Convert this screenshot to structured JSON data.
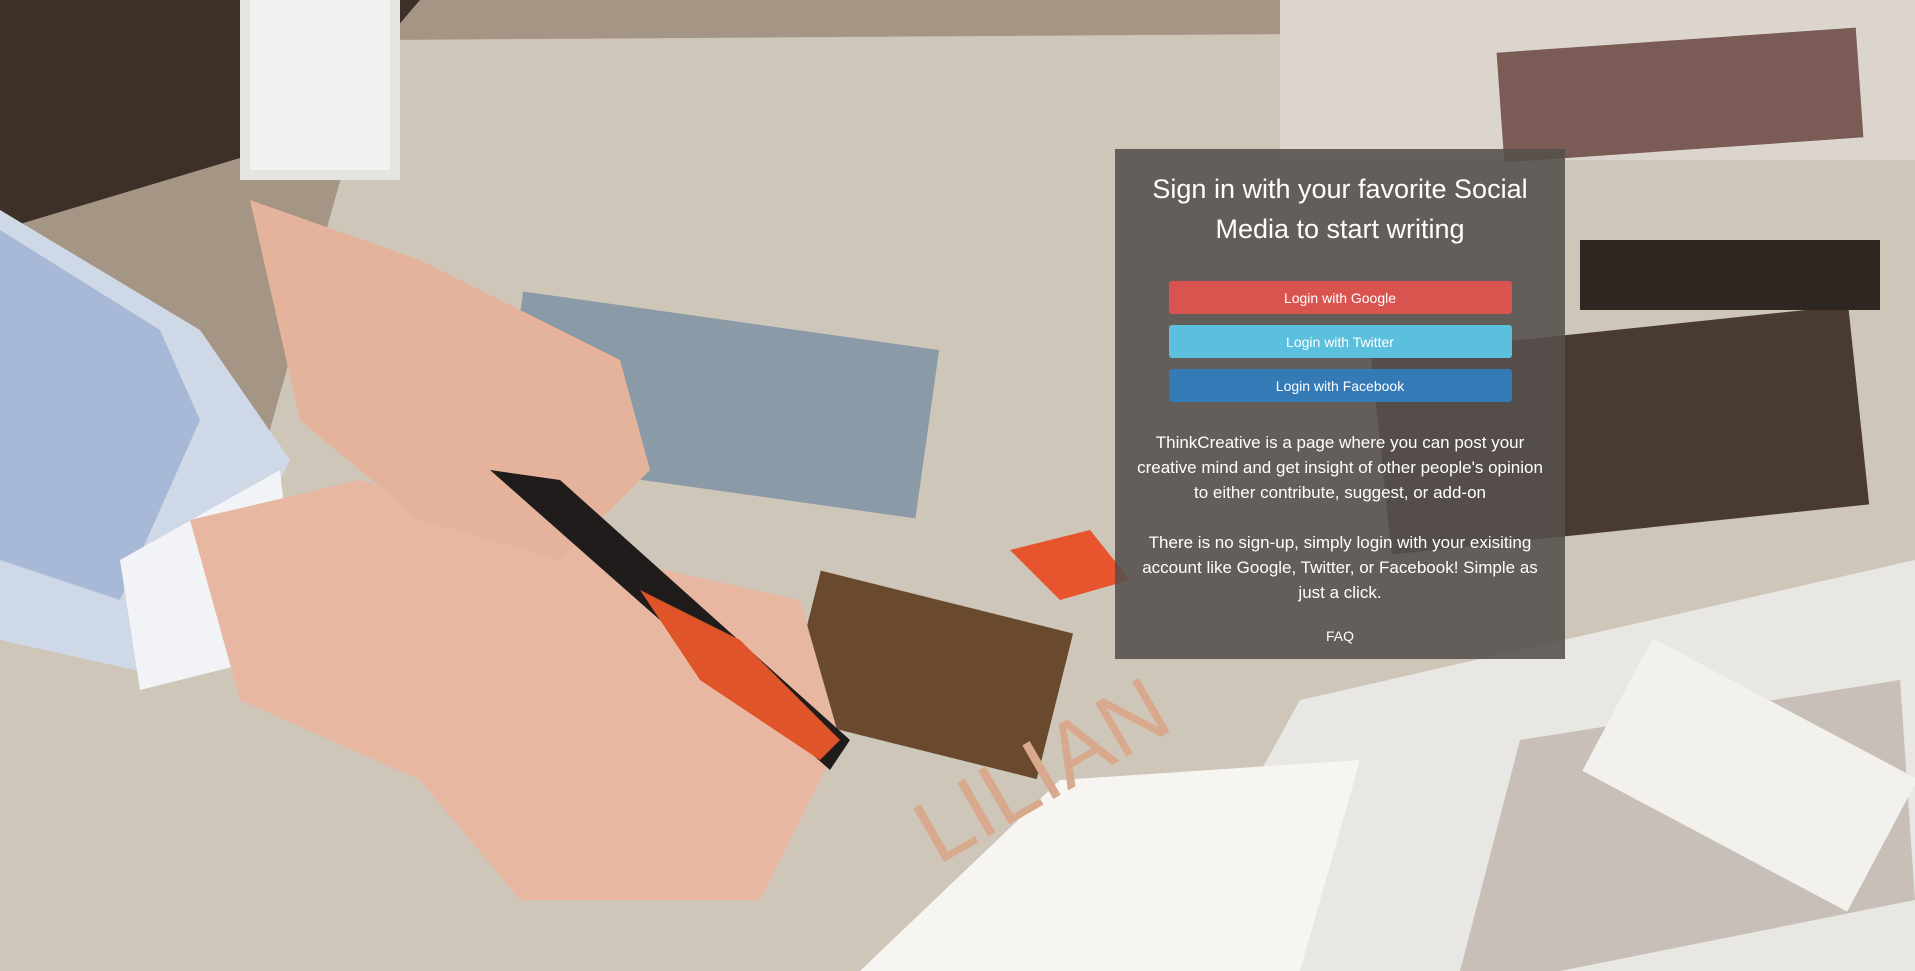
{
  "panel": {
    "title": "Sign in with your favorite Social Media to start writing",
    "buttons": {
      "google": "Login with Google",
      "twitter": "Login with Twitter",
      "facebook": "Login with Facebook"
    },
    "description_1": "ThinkCreative is a page where you can post your creative mind and get insight of other people's opinion to either contribute, suggest, or add-on",
    "description_2": "There is no sign-up, simply login with your exisiting account like Google, Twitter, or Facebook! Simple as just a click.",
    "faq_link": "FAQ"
  },
  "colors": {
    "google": "#d9534f",
    "twitter": "#5bc0de",
    "facebook": "#337ab7"
  }
}
